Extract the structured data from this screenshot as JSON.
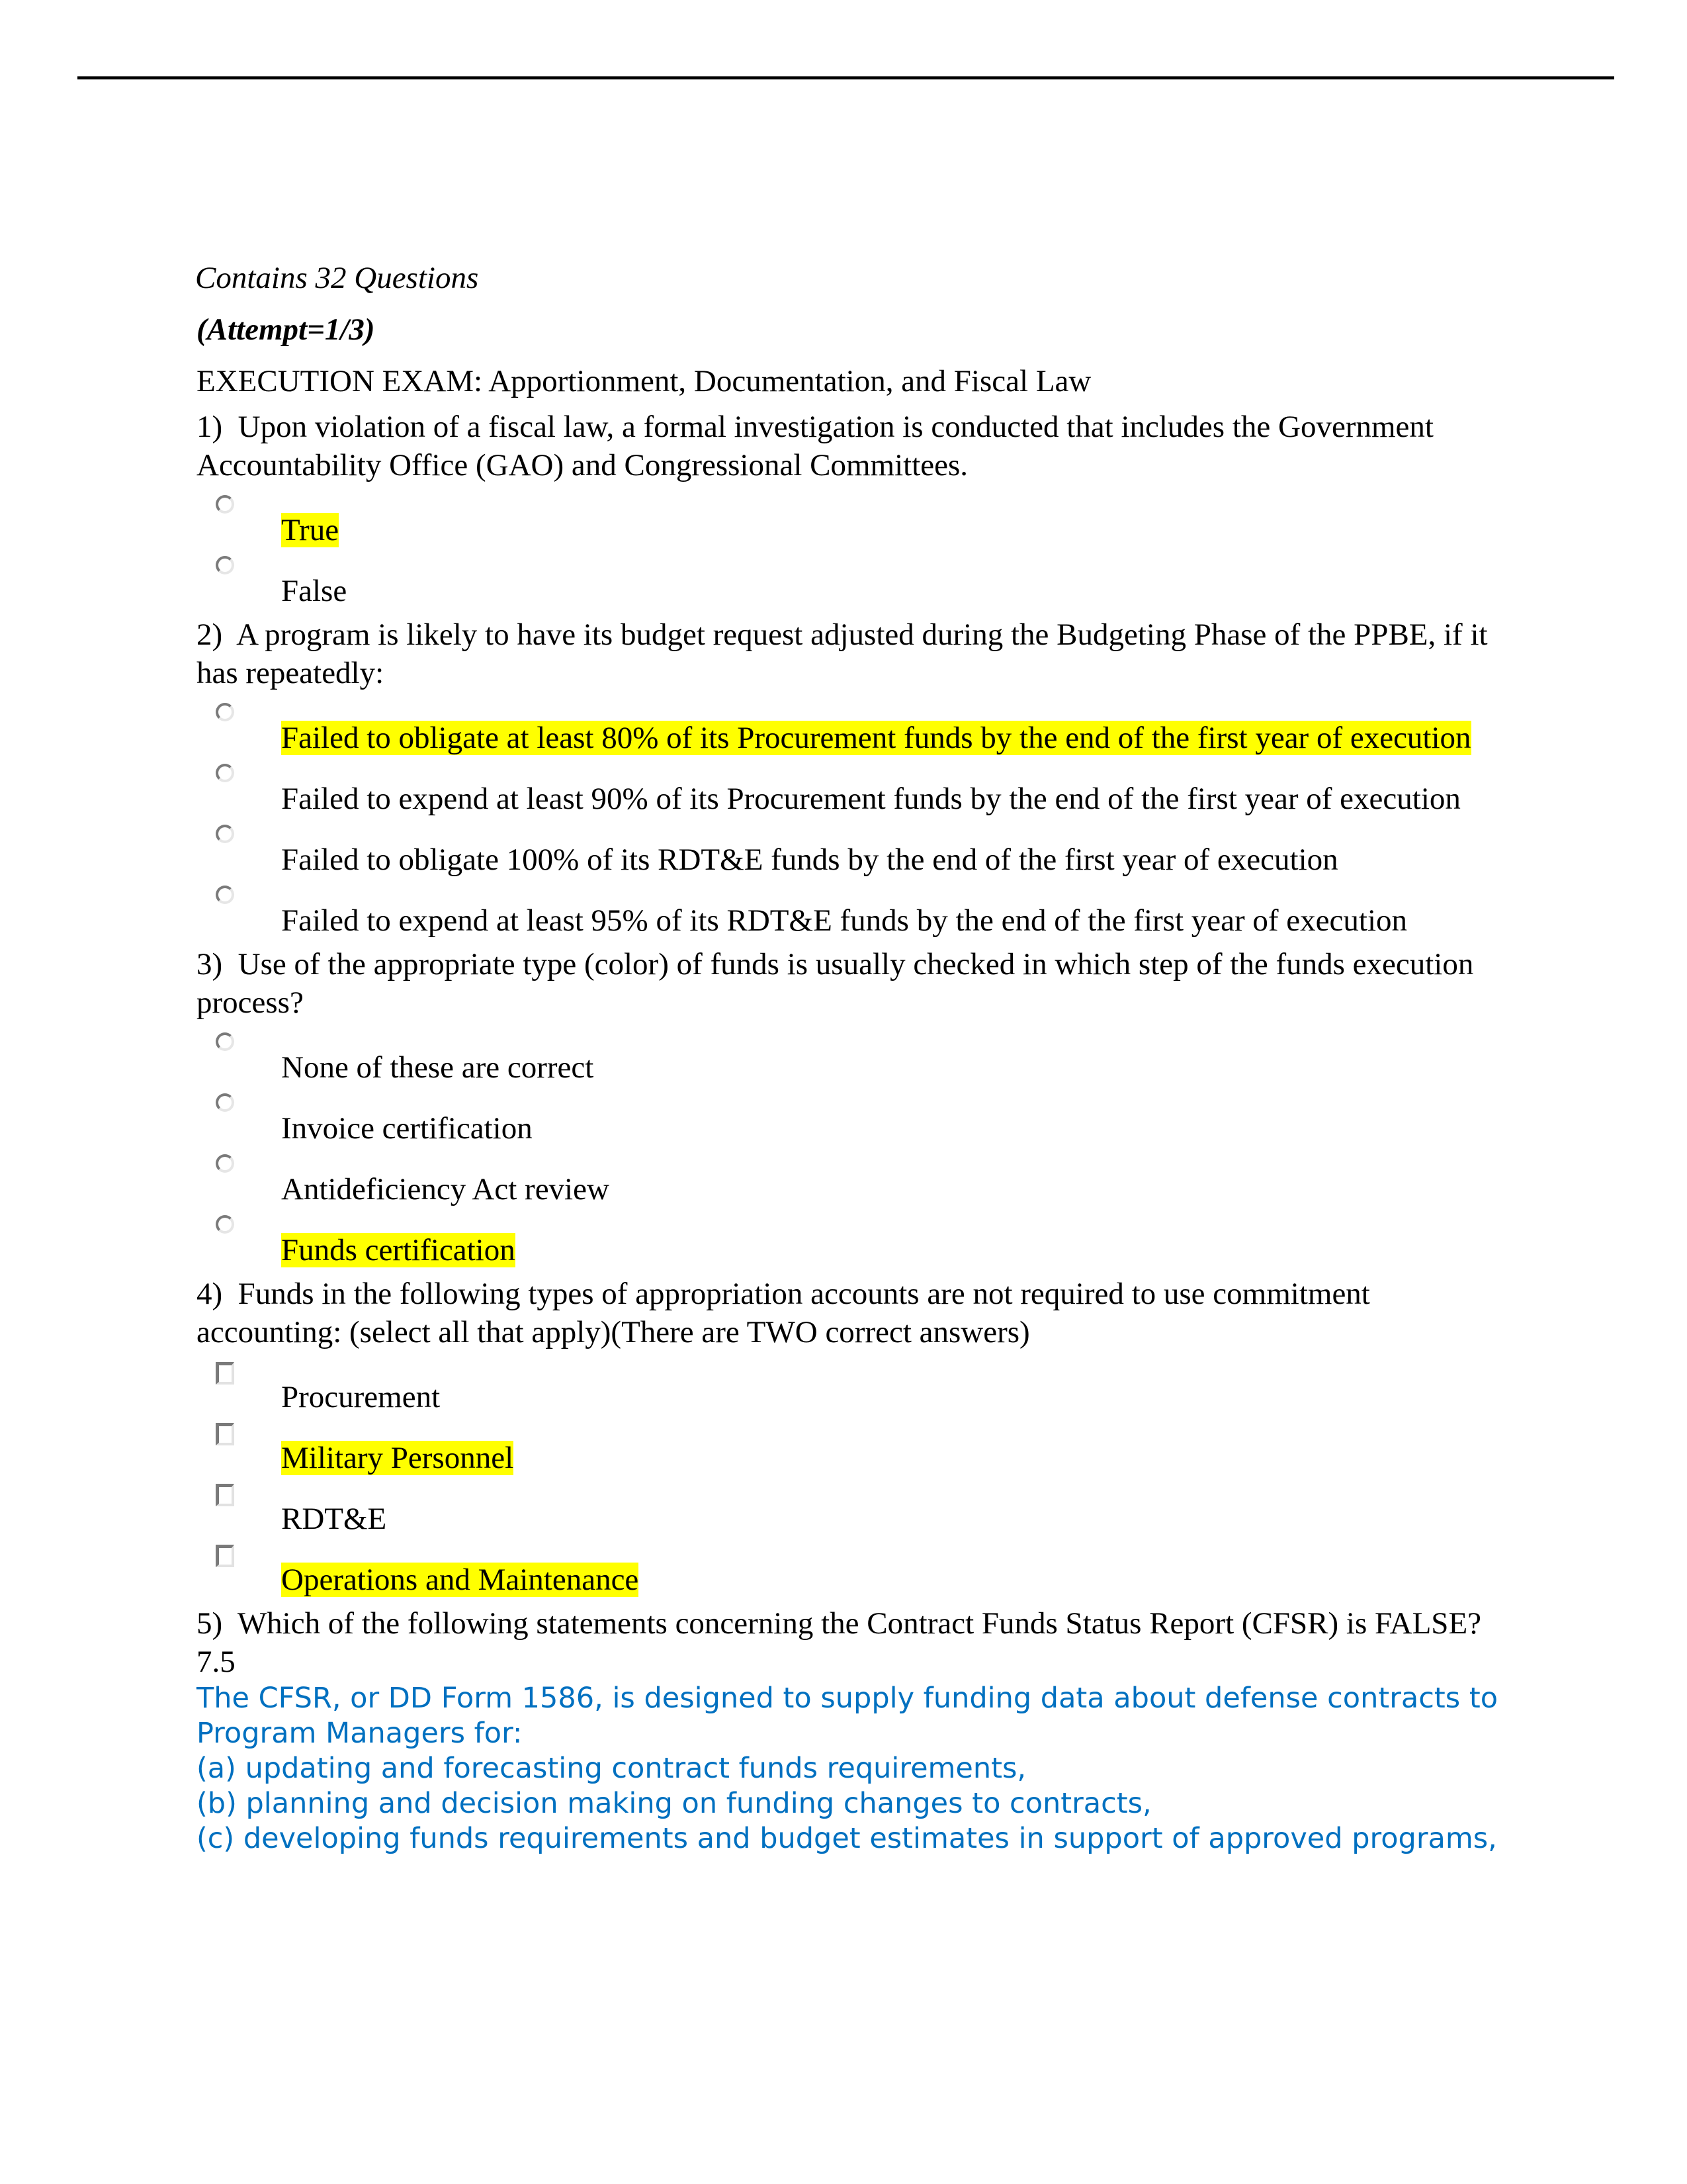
{
  "document": {
    "meta_count": "Contains 32  Questions",
    "meta_attempt": "(Attempt=1/3)",
    "exam_title": "EXECUTION EXAM: Apportionment, Documentation, and Fiscal Law",
    "highlight_color": "#ffff00",
    "answer_text_color": "#0070c0"
  },
  "questions": [
    {
      "number": "1)",
      "text": "Upon violation of a fiscal law, a formal investigation is conducted that includes the Government Accountability Office (GAO) and Congressional Committees.",
      "input_type": "radio",
      "options": [
        {
          "label": "True",
          "highlighted": true
        },
        {
          "label": "False",
          "highlighted": false
        }
      ]
    },
    {
      "number": "2)",
      "text": "A program is likely to have its budget request adjusted during the Budgeting Phase of the PPBE, if it has repeatedly:",
      "input_type": "radio",
      "options": [
        {
          "label": "Failed to obligate at least 80% of its Procurement funds by the end of the first year of execution",
          "highlighted": true
        },
        {
          "label": "Failed to expend at least 90% of its Procurement funds by the end of the first year of execution",
          "highlighted": false
        },
        {
          "label": "Failed to obligate 100% of its RDT&E funds by the end of the first year of execution",
          "highlighted": false
        },
        {
          "label": "Failed to expend at least 95% of its RDT&E funds by the end of the first year of execution",
          "highlighted": false
        }
      ]
    },
    {
      "number": "3)",
      "text": "Use of the appropriate type (color) of funds is usually checked in which step of the funds execution process?",
      "input_type": "radio",
      "options": [
        {
          "label": "None of these are correct",
          "highlighted": false
        },
        {
          "label": "Invoice certification",
          "highlighted": false
        },
        {
          "label": "Antideficiency Act review",
          "highlighted": false
        },
        {
          "label": "Funds certification",
          "highlighted": true
        }
      ]
    },
    {
      "number": "4)",
      "text": "Funds in the following types of appropriation accounts are not required to use commitment accounting: (select all that apply)(There are TWO correct answers)",
      "input_type": "checkbox",
      "options": [
        {
          "label": "Procurement",
          "highlighted": false
        },
        {
          "label": "Military Personnel",
          "highlighted": true
        },
        {
          "label": "RDT&E",
          "highlighted": false
        },
        {
          "label": "Operations and Maintenance",
          "highlighted": true
        }
      ]
    },
    {
      "number": "5)",
      "text": "Which of the following statements concerning the Contract Funds Status Report (CFSR) is FALSE? 7.5",
      "answer_notes": [
        "The CFSR, or DD Form 1586, is designed to supply funding data about defense contracts to Program Managers for:",
        "(a) updating and forecasting contract funds requirements,",
        "(b) planning and decision making on funding changes to contracts,",
        "(c) developing funds requirements and budget estimates in support of approved programs,"
      ]
    }
  ]
}
